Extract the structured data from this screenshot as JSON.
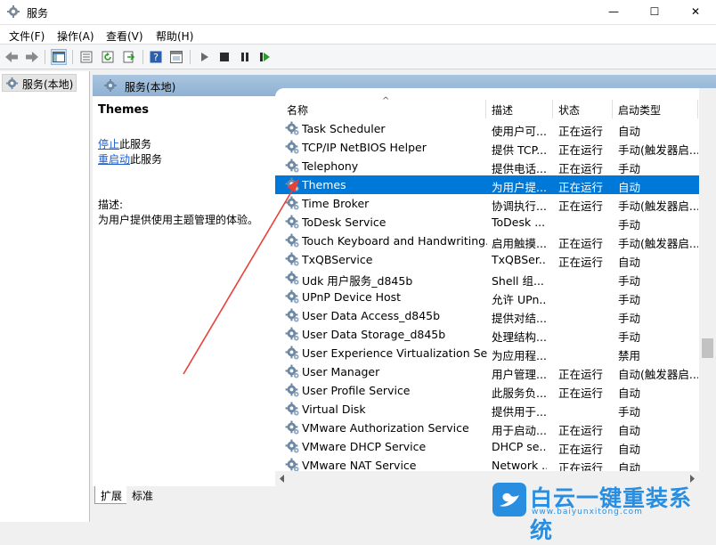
{
  "window": {
    "title": "服务",
    "minimize_glyph": "—",
    "maximize_glyph": "☐",
    "close_glyph": "✕"
  },
  "menu": [
    "文件(F)",
    "操作(A)",
    "查看(V)",
    "帮助(H)"
  ],
  "toolbar": {
    "icons": [
      "back-icon",
      "forward-icon",
      "show-hide-console-tree-icon",
      "properties-icon",
      "refresh-icon",
      "export-list-icon",
      "help-icon",
      "console-view-icon",
      "start-service-icon",
      "stop-service-icon",
      "pause-service-icon",
      "restart-service-icon"
    ]
  },
  "tree": {
    "root_label": "服务(本地)"
  },
  "main_header": {
    "label": "服务(本地)"
  },
  "details": {
    "title": "Themes",
    "stop_link": "停止",
    "stop_suffix": "此服务",
    "restart_link": "重启动",
    "restart_suffix": "此服务",
    "description_label": "描述:",
    "description_text": "为用户提供使用主题管理的体验。"
  },
  "columns": {
    "name": "名称",
    "description": "描述",
    "status": "状态",
    "startup_type": "启动类型"
  },
  "services": [
    {
      "name": "Task Scheduler",
      "description": "使用户可...",
      "status": "正在运行",
      "startup": "自动"
    },
    {
      "name": "TCP/IP NetBIOS Helper",
      "description": "提供 TCP...",
      "status": "正在运行",
      "startup": "手动(触发器启..."
    },
    {
      "name": "Telephony",
      "description": "提供电话...",
      "status": "正在运行",
      "startup": "手动"
    },
    {
      "name": "Themes",
      "description": "为用户提...",
      "status": "正在运行",
      "startup": "自动",
      "selected": true
    },
    {
      "name": "Time Broker",
      "description": "协调执行...",
      "status": "正在运行",
      "startup": "手动(触发器启..."
    },
    {
      "name": "ToDesk Service",
      "description": "ToDesk ...",
      "status": "",
      "startup": "手动"
    },
    {
      "name": "Touch Keyboard and Handwriting...",
      "description": "启用触摸...",
      "status": "正在运行",
      "startup": "手动(触发器启..."
    },
    {
      "name": "TxQBService",
      "description": "TxQBSer...",
      "status": "正在运行",
      "startup": "自动"
    },
    {
      "name": "Udk 用户服务_d845b",
      "description": "Shell 组...",
      "status": "",
      "startup": "手动"
    },
    {
      "name": "UPnP Device Host",
      "description": "允许 UPn...",
      "status": "",
      "startup": "手动"
    },
    {
      "name": "User Data Access_d845b",
      "description": "提供对结...",
      "status": "",
      "startup": "手动"
    },
    {
      "name": "User Data Storage_d845b",
      "description": "处理结构...",
      "status": "",
      "startup": "手动"
    },
    {
      "name": "User Experience Virtualization Ser...",
      "description": "为应用程...",
      "status": "",
      "startup": "禁用"
    },
    {
      "name": "User Manager",
      "description": "用户管理...",
      "status": "正在运行",
      "startup": "自动(触发器启..."
    },
    {
      "name": "User Profile Service",
      "description": "此服务负...",
      "status": "正在运行",
      "startup": "自动"
    },
    {
      "name": "Virtual Disk",
      "description": "提供用于...",
      "status": "",
      "startup": "手动"
    },
    {
      "name": "VMware Authorization Service",
      "description": "用于启动...",
      "status": "正在运行",
      "startup": "自动"
    },
    {
      "name": "VMware DHCP Service",
      "description": "DHCP se...",
      "status": "正在运行",
      "startup": "自动"
    },
    {
      "name": "VMware NAT Service",
      "description": "Network ...",
      "status": "正在运行",
      "startup": "自动"
    }
  ],
  "tabs": [
    "扩展",
    "标准"
  ],
  "watermark": {
    "text": "白云一键重装系统",
    "url": "www.baiyunxitong.com"
  },
  "colors": {
    "selection": "#0078d7",
    "link": "#1a5ccc",
    "annotation_arrow": "#e8413a",
    "watermark": "#2a8ee0"
  }
}
